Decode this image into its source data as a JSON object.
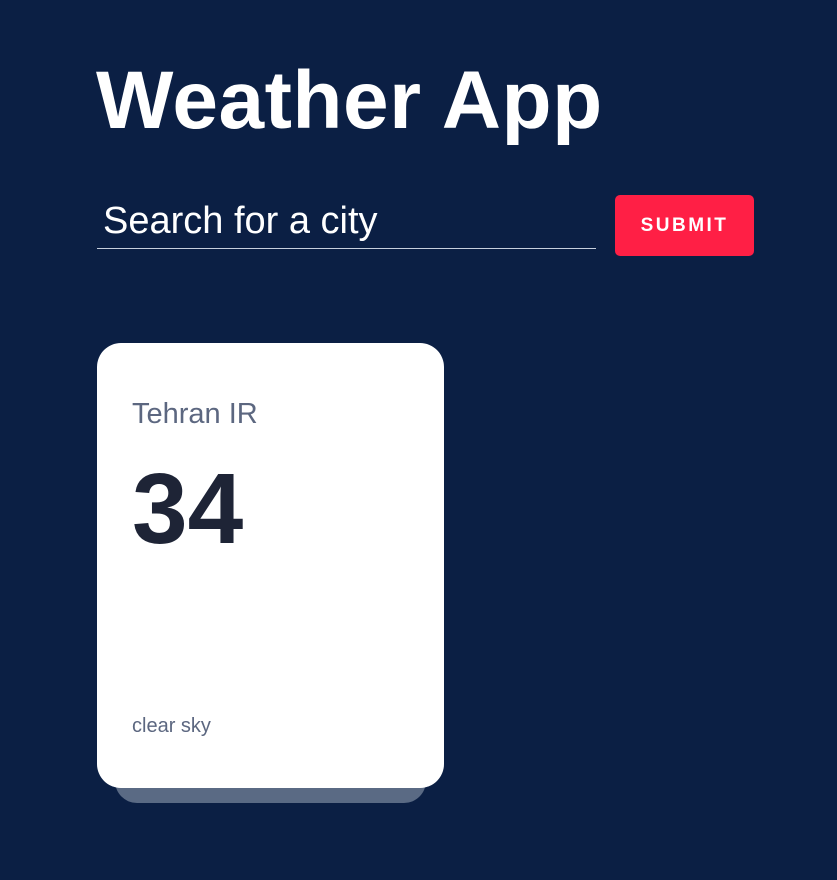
{
  "app": {
    "title": "Weather App"
  },
  "search": {
    "placeholder": "Search for a city",
    "value": "",
    "submit_label": "SUBMIT"
  },
  "cities": [
    {
      "name": "Tehran",
      "country": "IR",
      "display_name": "Tehran IR",
      "temperature": "34",
      "description": "clear sky"
    }
  ],
  "colors": {
    "background": "#0b1f44",
    "accent": "#ff1f45",
    "card": "#ffffff"
  }
}
